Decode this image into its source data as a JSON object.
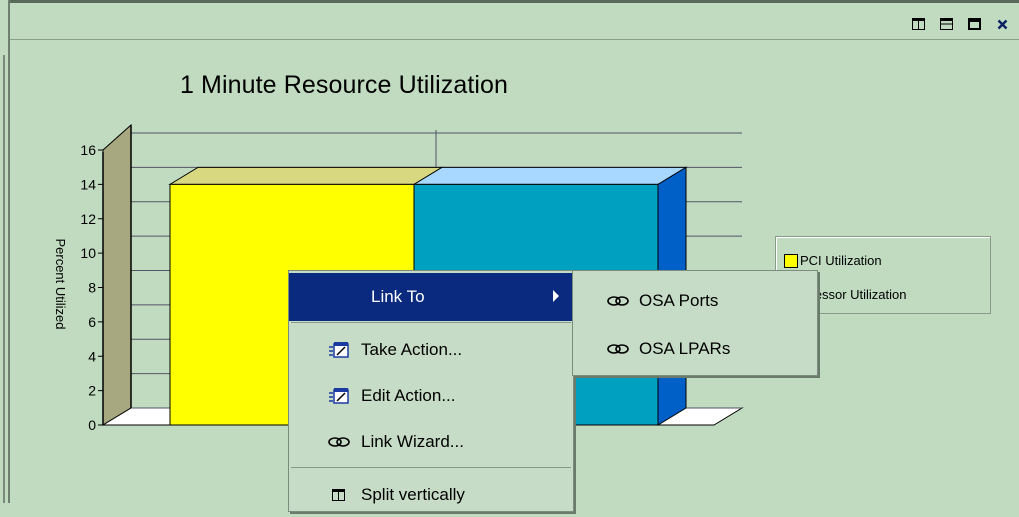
{
  "window": {
    "controls": [
      {
        "name": "split-vertical-icon"
      },
      {
        "name": "split-horizontal-icon"
      },
      {
        "name": "maximize-icon"
      },
      {
        "name": "close-icon",
        "glyph": "×"
      }
    ]
  },
  "chart_data": {
    "type": "bar",
    "title": "1 Minute Resource Utilization",
    "ylabel": "Percent Utilized",
    "xlabel": "",
    "ylim": [
      0,
      16
    ],
    "yticks": [
      0,
      2,
      4,
      6,
      8,
      10,
      12,
      14,
      16
    ],
    "categories": [
      ""
    ],
    "series": [
      {
        "name": "PCI Utilization",
        "values": [
          14
        ],
        "color": "#ffff00"
      },
      {
        "name": "Processor Utilization",
        "values": [
          14
        ],
        "color": "#00a0c0"
      }
    ],
    "legend_position": "right",
    "grid": true
  },
  "legend": {
    "items": [
      {
        "label": "PCI Utilization",
        "color": "#ffff00"
      },
      {
        "label": "Processor Utilization",
        "color": "#00a0c0"
      }
    ]
  },
  "context_menu": {
    "items": [
      {
        "label": "Link To",
        "icon": "submenu-arrow",
        "selected": true
      },
      {
        "label": "Take Action...",
        "icon": "take-action-icon"
      },
      {
        "label": "Edit Action...",
        "icon": "edit-action-icon"
      },
      {
        "label": "Link Wizard...",
        "icon": "link-icon"
      },
      {
        "label": "Split vertically",
        "icon": "split-vertical-icon"
      }
    ],
    "submenu": [
      {
        "label": "OSA Ports",
        "icon": "link-icon"
      },
      {
        "label": "OSA LPARs",
        "icon": "link-icon"
      }
    ]
  },
  "colors": {
    "background": "#c0dbc0",
    "selected": "#0a2a80",
    "wall": "#a8a880"
  }
}
